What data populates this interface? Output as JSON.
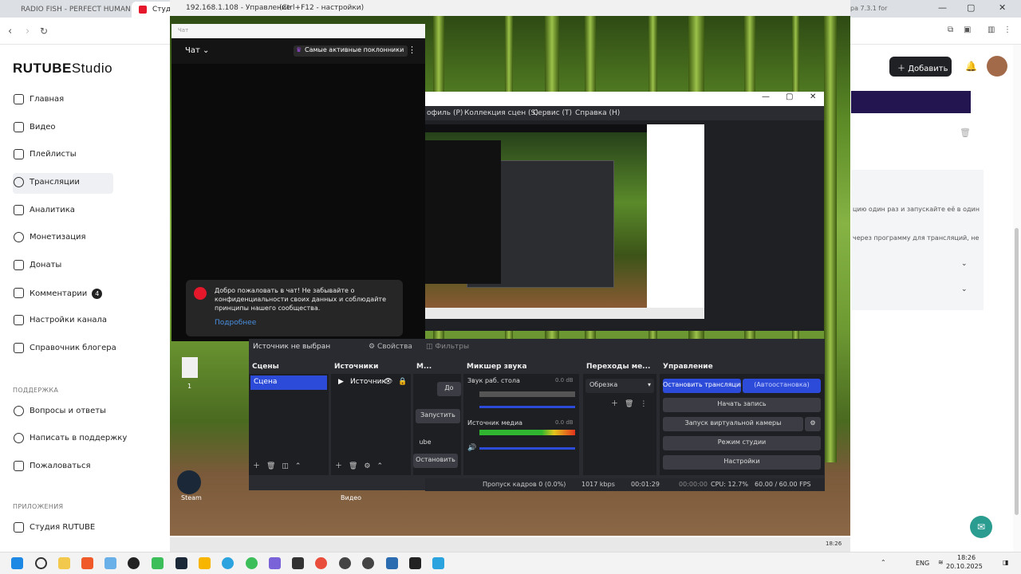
{
  "browser": {
    "tabs": [
      {
        "label": "RADIO FISH - PERFECT HUMAN (mo..."
      },
      {
        "label": "Студия"
      }
    ],
    "right_label": "ра 7.3.1 for"
  },
  "remote": {
    "title": "192.168.1.108 - Управление",
    "hint": "(Ctrl+F12 - настройки)"
  },
  "rutube": {
    "logo_main": "RUTUBE",
    "logo_sub": "Studio",
    "nav": [
      {
        "label": "Главная",
        "icon": "home-icon"
      },
      {
        "label": "Видео",
        "icon": "video-icon"
      },
      {
        "label": "Плейлисты",
        "icon": "playlist-icon"
      },
      {
        "label": "Трансляции",
        "icon": "broadcast-icon"
      },
      {
        "label": "Аналитика",
        "icon": "analytics-icon"
      },
      {
        "label": "Монетизация",
        "icon": "monetization-icon"
      },
      {
        "label": "Донаты",
        "icon": "donate-icon"
      },
      {
        "label": "Комментарии",
        "icon": "comments-icon",
        "badge": "4"
      },
      {
        "label": "Настройки канала",
        "icon": "settings-icon"
      },
      {
        "label": "Справочник блогера",
        "icon": "guide-icon"
      }
    ],
    "support_title": "ПОДДЕРЖКА",
    "support": [
      {
        "label": "Вопросы и ответы"
      },
      {
        "label": "Написать в поддержку"
      },
      {
        "label": "Пожаловаться"
      }
    ],
    "apps_title": "ПРИЛОЖЕНИЯ",
    "apps": [
      {
        "label": "Студия RUTUBE"
      }
    ],
    "add_button": "Добавить",
    "right_text1": "цию один раз и запускайте её в один",
    "right_text2": "через программу для трансляций, не"
  },
  "chat": {
    "header": "Чат",
    "title": "Чат",
    "top_fans": "Самые активные поклонники",
    "welcome": "Добро пожаловать в чат! Не забывайте о конфиденциальности своих данных и соблюдайте принципы нашего сообщества.",
    "more": "Подробнее"
  },
  "obs": {
    "menu": [
      "офиль (P)",
      "Коллекция сцен (S)",
      "Сервис (T)",
      "Справка (H)"
    ],
    "no_source": "Источник не выбран",
    "properties": "Свойства",
    "filters": "Фильтры",
    "scenes_title": "Сцены",
    "scene": "Сцена",
    "sources_title": "Источники",
    "source": "Источник",
    "media_title": "М...",
    "media_btn1": "До",
    "media_btn2": "Запустить",
    "media_btn3": "ube",
    "media_btn4": "Остановить",
    "mixer_title": "Микшер звука",
    "track1": "Звук раб. стола",
    "track1_db": "0.0 dB",
    "track2": "Источник медиа",
    "track2_db": "0.0 dB",
    "transitions_title": "Переходы ме...",
    "transition": "Обрезка",
    "controls_title": "Управление",
    "stop_stream": "Остановить трансляцию",
    "auto_stop": "(Автоостановка)",
    "start_record": "Начать запись",
    "virtual_cam": "Запуск виртуальной камеры",
    "studio_mode": "Режим студии",
    "settings": "Настройки",
    "status": {
      "dropped": "Пропуск кадров 0 (0.0%)",
      "bitrate": "1017 kbps",
      "stream_time": "00:01:29",
      "rec_time": "00:00:00",
      "cpu": "CPU: 12.7%",
      "fps": "60.00 / 60.00 FPS"
    }
  },
  "desktop": {
    "steam": "Steam",
    "video": "Видео",
    "file": "1"
  },
  "taskbar": {
    "lang": "ENG",
    "time": "18:26",
    "date": "20.10.2025",
    "remote_time": "18:26"
  }
}
